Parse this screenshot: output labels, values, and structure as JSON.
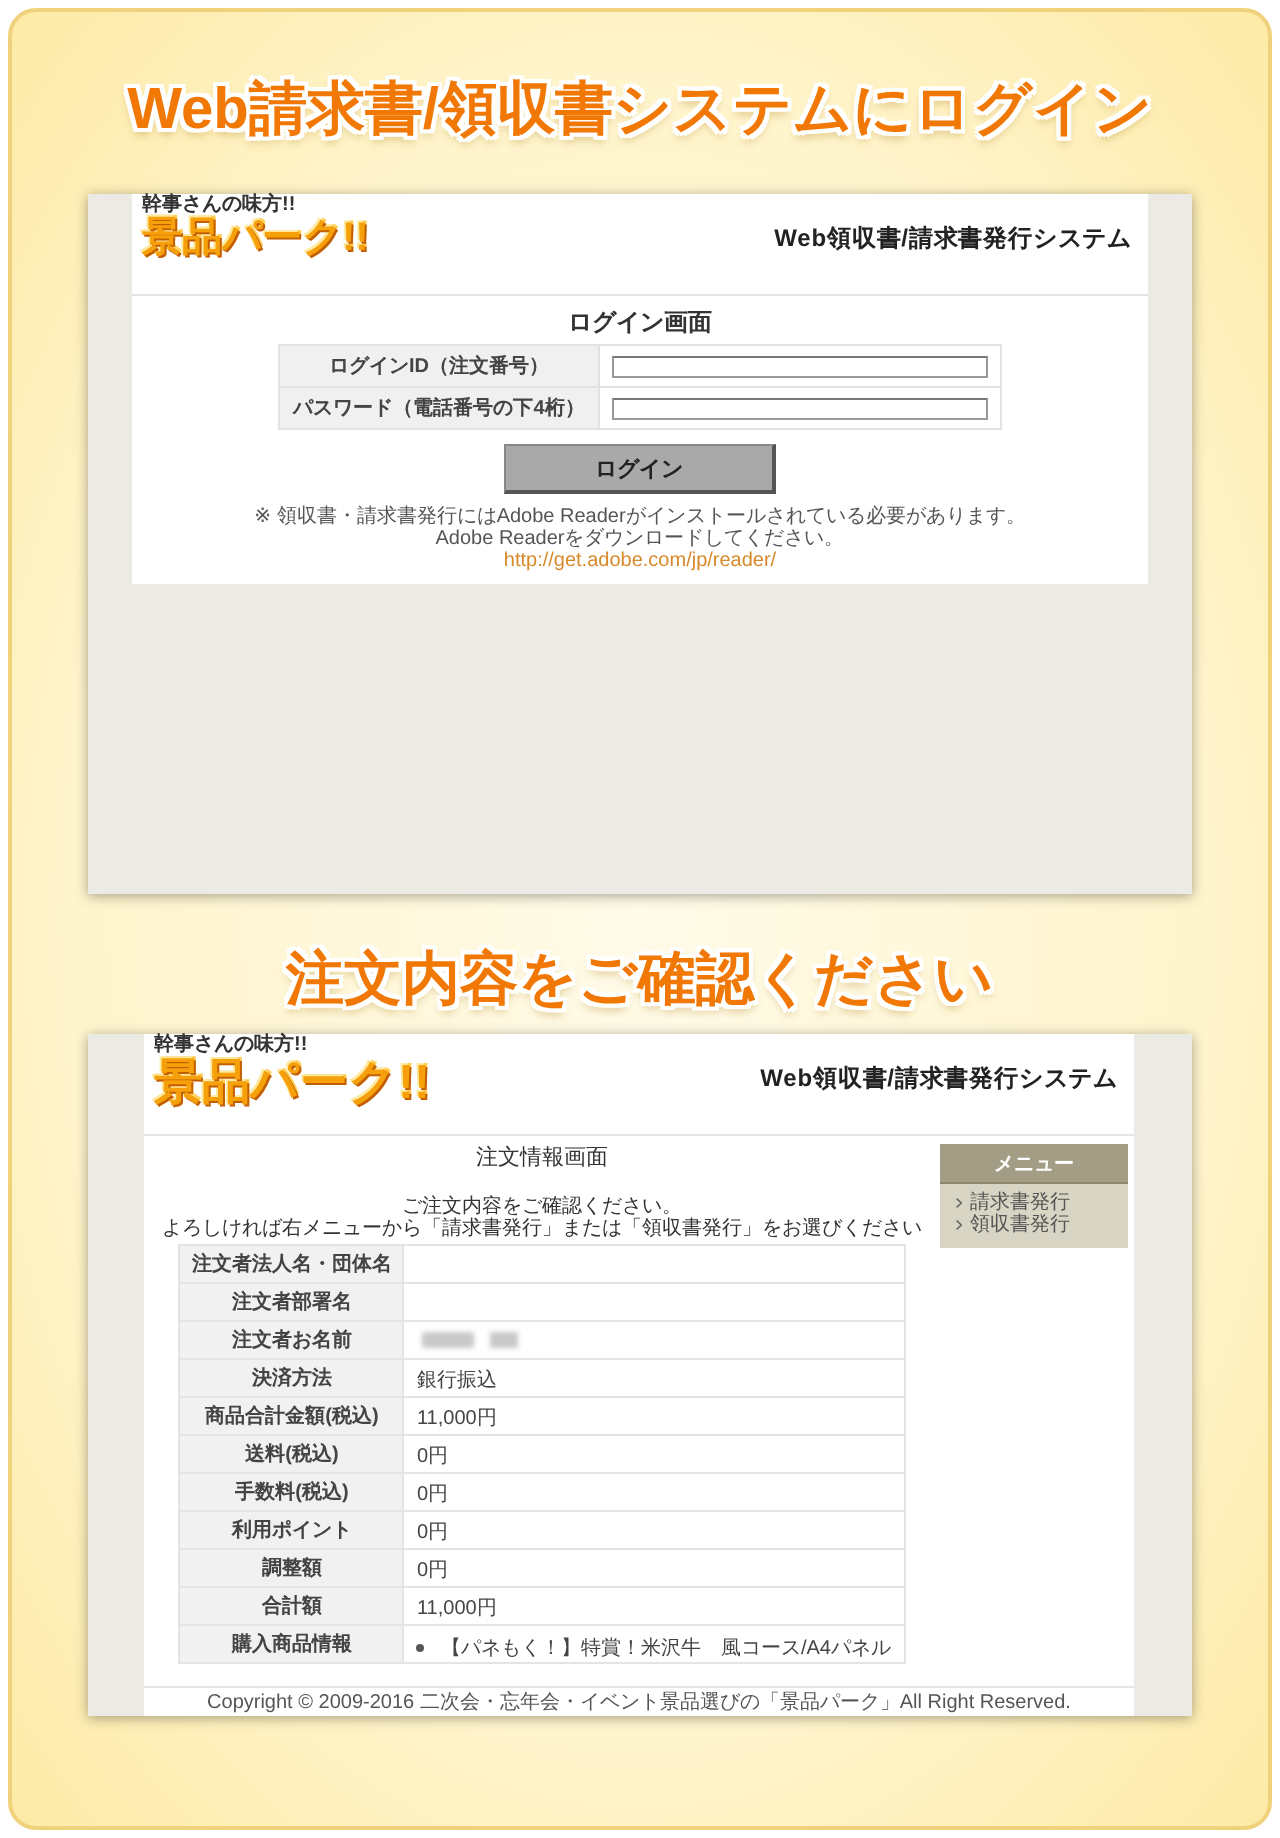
{
  "login_section": {
    "heading": "Web請求書/領収書システムにログイン",
    "screen": {
      "logo": {
        "tagline": "幹事さんの味方!!",
        "text": "景品パーク!!"
      },
      "system_title": "Web領収書/請求書発行システム",
      "page_title": "ログイン画面",
      "fields": [
        {
          "label": "ログインID（注文番号）"
        },
        {
          "label": "パスワード（電話番号の下4桁）"
        }
      ],
      "button": "ログイン",
      "notes": [
        "※ 領収書・請求書発行にはAdobe Readerがインストールされている必要があります。",
        "Adobe Readerをダウンロードしてください。"
      ],
      "link": "http://get.adobe.com/jp/reader/"
    }
  },
  "order_section": {
    "heading": "注文内容をご確認ください",
    "screen": {
      "logo": {
        "tagline": "幹事さんの味方!!",
        "text": "景品パーク!!"
      },
      "system_title": "Web領収書/請求書発行システム",
      "page_title": "注文情報画面",
      "messages": [
        "ご注文内容をご確認ください。",
        "よろしければ右メニューから「請求書発行」または「領収書発行」をお選びください"
      ],
      "table": {
        "rows": [
          {
            "label": "注文者法人名・団体名",
            "kind": "text"
          },
          {
            "label": "注文者部署名",
            "kind": "text"
          },
          {
            "label": "注文者お名前",
            "kind": "blurred"
          },
          {
            "label": "決済方法",
            "kind": "text",
            "value": "銀行振込"
          },
          {
            "label": "商品合計金額(税込)",
            "kind": "text",
            "value": "11,000円"
          },
          {
            "label": "送料(税込)",
            "kind": "text",
            "value": "0円"
          },
          {
            "label": "手数料(税込)",
            "kind": "text",
            "value": "0円"
          },
          {
            "label": "利用ポイント",
            "kind": "text",
            "value": "0円"
          },
          {
            "label": "調整額",
            "kind": "text",
            "value": "0円"
          },
          {
            "label": "合計額",
            "kind": "text",
            "value": "11,000円"
          },
          {
            "label": "購入商品情報",
            "kind": "list",
            "items": [
              "【パネもく！】特賞！米沢牛　風コース/A4パネル"
            ]
          }
        ]
      },
      "menu": {
        "title": "メニュー",
        "items": [
          {
            "label": "請求書発行"
          },
          {
            "label": "領収書発行"
          }
        ]
      },
      "footer": "Copyright © 2009-2016 二次会・忘年会・イベント景品選びの「景品パーク」All Right Reserved."
    }
  }
}
